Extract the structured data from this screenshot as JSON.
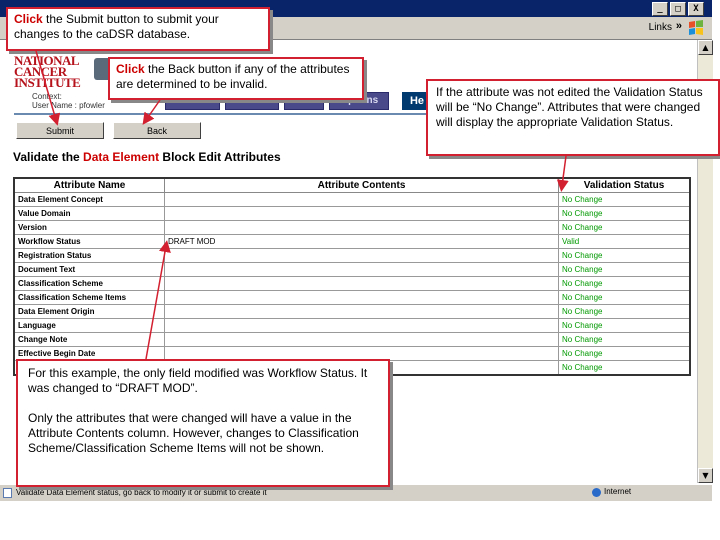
{
  "browser": {
    "window_buttons": [
      "_",
      "□",
      "X"
    ],
    "links_label": "Links",
    "links_chevron": "»",
    "status_text": "Validate Data Element status, go back to modify it or submit to create it",
    "zone": "Internet"
  },
  "header": {
    "logo_lines": [
      "NATIONAL",
      "CANCER",
      "INSTITUTE"
    ],
    "context_label": "Context:",
    "user_label": "User Name : pfowler",
    "nav": [
      "Search",
      "Create",
      "Edit",
      "Options"
    ],
    "help": "He"
  },
  "buttons": {
    "submit": "Submit",
    "back": "Back"
  },
  "title": {
    "prefix": "Validate the",
    "highlight": "Data Element",
    "suffix": "Block Edit Attributes"
  },
  "table": {
    "headers": [
      "Attribute Name",
      "Attribute Contents",
      "Validation Status"
    ],
    "rows": [
      {
        "name": "Data Element Concept",
        "content": "",
        "status": "No Change"
      },
      {
        "name": "Value Domain",
        "content": "",
        "status": "No Change"
      },
      {
        "name": "Version",
        "content": "",
        "status": "No Change"
      },
      {
        "name": "Workflow Status",
        "content": "DRAFT MOD",
        "status": "Valid"
      },
      {
        "name": "Registration Status",
        "content": "",
        "status": "No Change"
      },
      {
        "name": "Document Text",
        "content": "",
        "status": "No Change"
      },
      {
        "name": "Classification Scheme",
        "content": "",
        "status": "No Change"
      },
      {
        "name": "Classification Scheme Items",
        "content": "",
        "status": "No Change"
      },
      {
        "name": "Data Element Origin",
        "content": "",
        "status": "No Change"
      },
      {
        "name": "Language",
        "content": "",
        "status": "No Change"
      },
      {
        "name": "Change Note",
        "content": "",
        "status": "No Change"
      },
      {
        "name": "Effective Begin Date",
        "content": "",
        "status": "No Change"
      },
      {
        "name": "",
        "content": "",
        "status": "No Change"
      }
    ]
  },
  "callouts": {
    "submit": {
      "action": "Click",
      "text": " the Submit button to submit your changes to the caDSR database."
    },
    "back": {
      "action": "Click",
      "text": " the Back button if any of the attributes are determined to be invalid."
    },
    "status": {
      "text": "If the attribute was not edited the Validation Status will be “No Change”.  Attributes that were changed will display the appropriate Validation Status."
    },
    "example": {
      "p1": "For this example, the only field modified was Workflow Status.  It was changed to “DRAFT MOD”.",
      "p2": "Only the attributes that were changed will have a value in the Attribute Contents column.  However, changes to Classification Scheme/Classification Scheme Items will not be shown."
    }
  },
  "colors": {
    "callout_border": "#d32030",
    "status_green": "#009900",
    "highlight_red": "#cc0000"
  }
}
